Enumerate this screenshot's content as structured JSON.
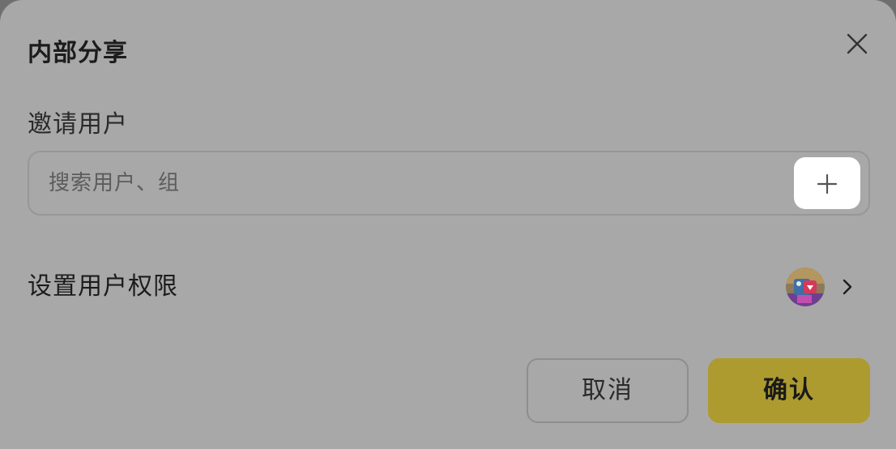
{
  "dialog": {
    "title": "内部分享",
    "close_icon": "close-icon"
  },
  "invite": {
    "label": "邀请用户",
    "placeholder": "搜索用户、组",
    "value": "",
    "add_icon": "plus-icon"
  },
  "permissions": {
    "label": "设置用户权限",
    "avatar_icon": "user-avatar",
    "chevron_icon": "chevron-right-icon"
  },
  "actions": {
    "cancel_label": "取消",
    "confirm_label": "确认"
  },
  "colors": {
    "overlay_dialog_bg": "#a8a8a8",
    "confirm_bg": "#ad9b2f",
    "add_button_bg": "#ffffff"
  }
}
